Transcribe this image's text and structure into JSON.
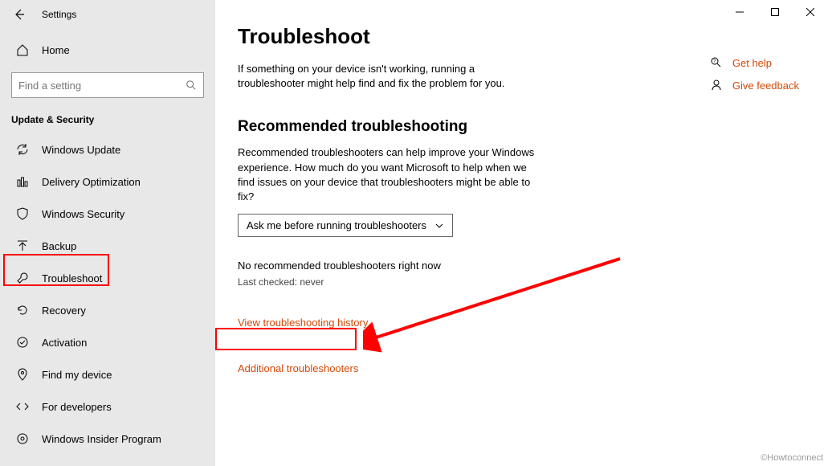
{
  "window": {
    "title": "Settings"
  },
  "sidebar": {
    "home_label": "Home",
    "search_placeholder": "Find a setting",
    "category": "Update & Security",
    "items": [
      {
        "label": "Windows Update"
      },
      {
        "label": "Delivery Optimization"
      },
      {
        "label": "Windows Security"
      },
      {
        "label": "Backup"
      },
      {
        "label": "Troubleshoot"
      },
      {
        "label": "Recovery"
      },
      {
        "label": "Activation"
      },
      {
        "label": "Find my device"
      },
      {
        "label": "For developers"
      },
      {
        "label": "Windows Insider Program"
      }
    ]
  },
  "main": {
    "title": "Troubleshoot",
    "intro": "If something on your device isn't working, running a troubleshooter might help find and fix the problem for you.",
    "recommended": {
      "heading": "Recommended troubleshooting",
      "body": "Recommended troubleshooters can help improve your Windows experience. How much do you want Microsoft to help when we find issues on your device that troubleshooters might be able to fix?",
      "dropdown_value": "Ask me before running troubleshooters",
      "status": "No recommended troubleshooters right now",
      "last_checked": "Last checked: never"
    },
    "links": {
      "history": "View troubleshooting history",
      "additional": "Additional troubleshooters"
    }
  },
  "right": {
    "help": "Get help",
    "feedback": "Give feedback"
  },
  "watermark": "©Howtoconnect"
}
